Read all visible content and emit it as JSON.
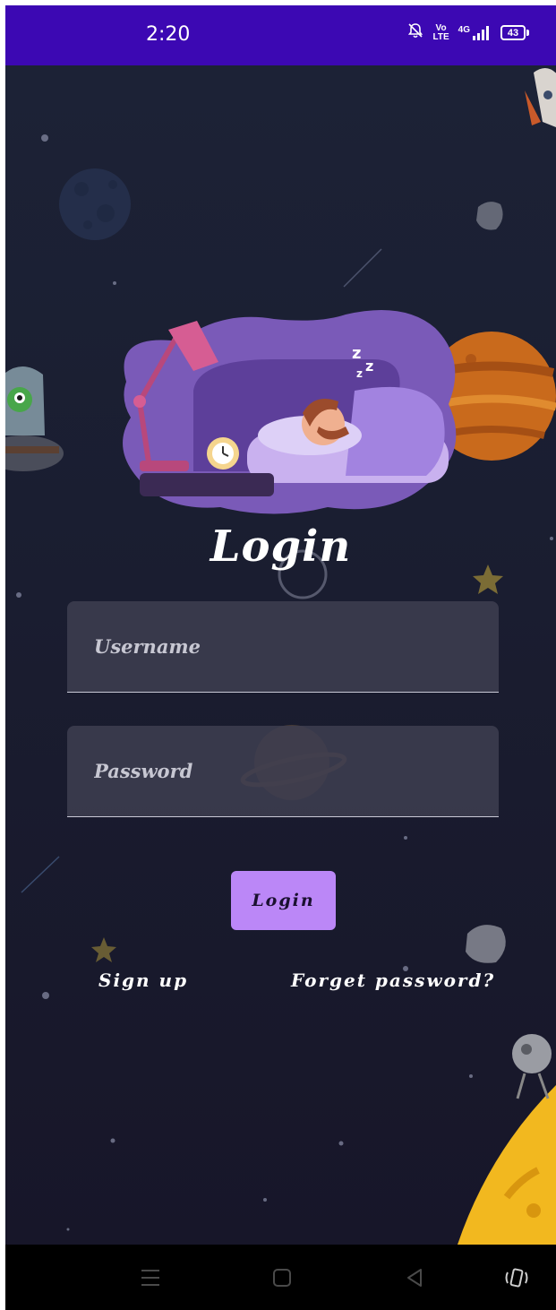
{
  "status_bar": {
    "time": "2:20",
    "network_top": "Vo",
    "network_bottom": "LTE",
    "signal_label": "4G",
    "battery": "43",
    "background": "#3c08b3",
    "icons": [
      "bell-off-icon",
      "volte-icon",
      "signal-icon",
      "battery-icon"
    ]
  },
  "login": {
    "title": "Login",
    "username_placeholder": "Username",
    "password_placeholder": "Password",
    "button_label": "Login",
    "signup_label": "Sign up",
    "forgot_label": "Forget password?",
    "button_color": "#bb87f7"
  },
  "nav": {
    "items": [
      "menu-icon",
      "home-icon",
      "back-icon",
      "rotate-icon"
    ]
  }
}
